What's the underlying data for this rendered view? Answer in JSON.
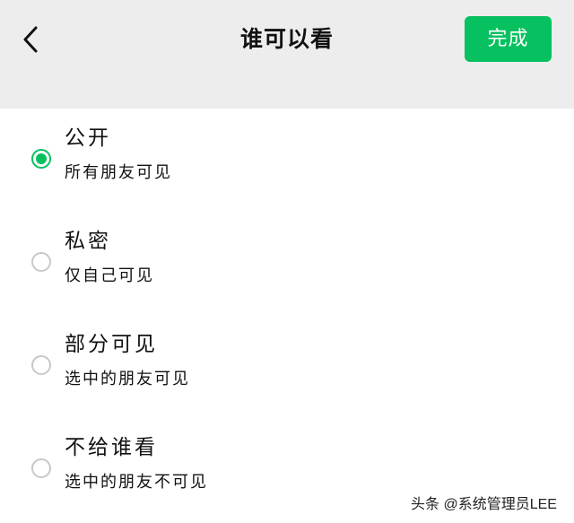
{
  "header": {
    "back_icon": "chevron-left-icon",
    "title": "谁可以看",
    "done_label": "完成",
    "done_color": "#07c160"
  },
  "options": [
    {
      "title": "公开",
      "subtitle": "所有朋友可见",
      "selected": true
    },
    {
      "title": "私密",
      "subtitle": "仅自己可见",
      "selected": false
    },
    {
      "title": "部分可见",
      "subtitle": "选中的朋友可见",
      "selected": false
    },
    {
      "title": "不给谁看",
      "subtitle": "选中的朋友不可见",
      "selected": false
    }
  ],
  "watermark": "头条 @系统管理员LEE",
  "colors": {
    "header_bg": "#ededed",
    "accent": "#07c160",
    "radio_border": "#c8c8c8"
  }
}
